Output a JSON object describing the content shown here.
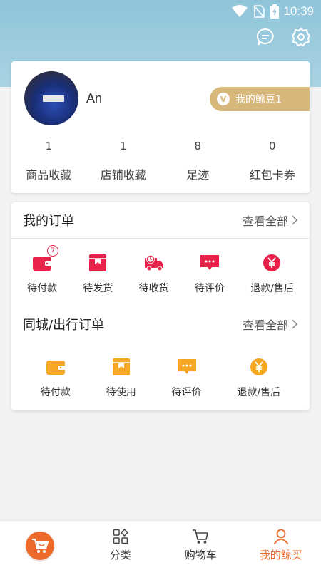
{
  "status_bar": {
    "time": "10:39"
  },
  "header": {
    "icons": [
      "chat-icon",
      "gear-icon"
    ]
  },
  "profile": {
    "username": "An",
    "beans_label": "我的鲸豆1",
    "beans_badge": "V",
    "stats": [
      {
        "value": "1",
        "label": "商品收藏"
      },
      {
        "value": "1",
        "label": "店铺收藏"
      },
      {
        "value": "8",
        "label": "足迹"
      },
      {
        "value": "0",
        "label": "红包卡券"
      }
    ]
  },
  "my_orders": {
    "title": "我的订单",
    "view_all": "查看全部",
    "items": [
      {
        "label": "待付款",
        "icon": "wallet-icon",
        "badge": "7"
      },
      {
        "label": "待发货",
        "icon": "box-icon"
      },
      {
        "label": "待收货",
        "icon": "delivery-truck-icon"
      },
      {
        "label": "待评价",
        "icon": "comment-icon"
      },
      {
        "label": "退款/售后",
        "icon": "refund-yen-icon"
      }
    ]
  },
  "local_orders": {
    "title": "同城/出行订单",
    "view_all": "查看全部",
    "items": [
      {
        "label": "待付款",
        "icon": "wallet-icon"
      },
      {
        "label": "待使用",
        "icon": "box-icon"
      },
      {
        "label": "待评价",
        "icon": "comment-icon"
      },
      {
        "label": "退款/售后",
        "icon": "refund-yen-icon"
      }
    ]
  },
  "bottom_nav": [
    {
      "label": "",
      "icon": "home-shop-icon"
    },
    {
      "label": "分类",
      "icon": "category-icon"
    },
    {
      "label": "购物车",
      "icon": "cart-icon"
    },
    {
      "label": "我的鲸买",
      "icon": "user-icon",
      "active": true
    }
  ],
  "colors": {
    "accent_red": "#e8224a",
    "accent_yellow": "#f5a623",
    "accent_orange": "#ee6a2b",
    "gold": "#d7b77a",
    "header_blue": "#8fc4d9"
  }
}
